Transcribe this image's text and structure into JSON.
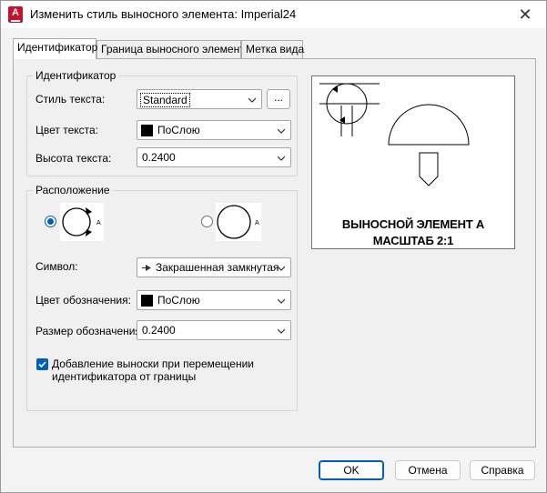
{
  "window": {
    "title": "Изменить стиль выносного элемента: Imperial24",
    "close_symbol": "✕",
    "app_icon": "autocad-logo-icon",
    "app_icon_letter": "A"
  },
  "tabs": [
    {
      "label": "Идентификатор",
      "active": true
    },
    {
      "label": "Граница выносного элемента",
      "active": false
    },
    {
      "label": "Метка вида",
      "active": false
    }
  ],
  "identifier_group": {
    "legend": "Идентификатор",
    "text_style": {
      "label": "Стиль текста:",
      "value": "Standard",
      "browse": "..."
    },
    "text_color": {
      "label": "Цвет текста:",
      "value": "ПоСлою",
      "swatch": "#000000"
    },
    "text_height": {
      "label": "Высота текста:",
      "value": "0.2400"
    }
  },
  "placement_group": {
    "legend": "Расположение",
    "options": [
      {
        "name": "arrows-on-circle",
        "selected": true,
        "letter": "A"
      },
      {
        "name": "plain-circle",
        "selected": false,
        "letter": "A"
      }
    ],
    "symbol": {
      "label": "Символ:",
      "value": "Закрашенная замкнутая",
      "icon": "closed-filled-arrow-icon"
    },
    "mark_color": {
      "label": "Цвет обозначения:",
      "value": "ПоСлою",
      "swatch": "#000000"
    },
    "mark_size": {
      "label": "Размер обозначения:",
      "value": "0.2400"
    },
    "add_leader": {
      "label_line1": "Добавление выноски при перемещении",
      "label_line2": "идентификатора от границы",
      "checked": true
    }
  },
  "preview": {
    "line1": "ВЫНОСНОЙ ЭЛЕМЕНТ А",
    "line2": "МАСШТАБ 2:1"
  },
  "buttons": {
    "ok": "OK",
    "cancel": "Отмена",
    "help": "Справка"
  },
  "colors": {
    "accent": "#005fb8",
    "brand": "#c8102e"
  }
}
